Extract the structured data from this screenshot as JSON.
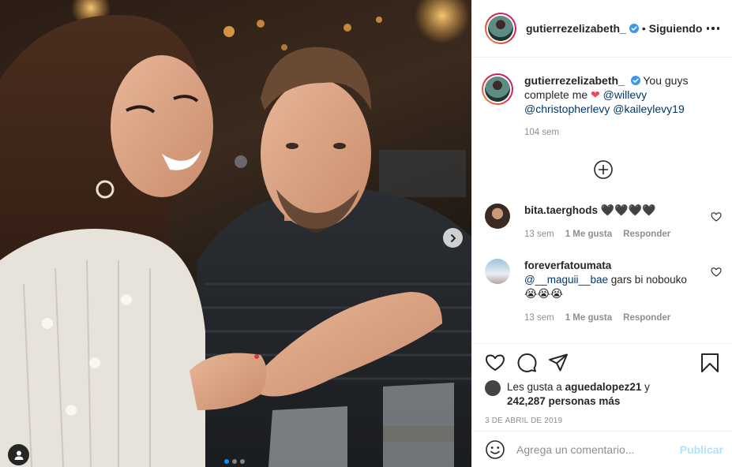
{
  "post": {
    "username": "gutierrezelizabeth_",
    "separator": "•",
    "follow_status": "Siguiendo"
  },
  "caption": {
    "username": "gutierrezelizabeth_",
    "text_1": "You guys complete me",
    "heart": "❤",
    "mention_1": "@willevy",
    "mention_2": "@christopherlevy",
    "mention_3": "@kaileylevy19",
    "time": "104 sem"
  },
  "comments": [
    {
      "username": "bita.taerghods",
      "text": "🖤🖤🖤🖤",
      "time": "13 sem",
      "likes": "1 Me gusta",
      "reply": "Responder"
    },
    {
      "username": "foreverfatoumata",
      "mention": "@__maguii__bae",
      "text": "gars bi nobouko",
      "emojis": "😭😭😭",
      "time": "13 sem",
      "likes": "1 Me gusta",
      "reply": "Responder"
    }
  ],
  "likes": {
    "prefix": "Les gusta a",
    "user": "aguedalopez21",
    "joiner": "y",
    "count": "242,287 personas más"
  },
  "date": "3 DE ABRIL DE 2019",
  "add_comment": {
    "placeholder": "Agrega un comentario...",
    "publish": "Publicar"
  },
  "carousel": {
    "current_index": 1,
    "total": 3
  },
  "colors": {
    "link": "#00376b",
    "verified": "#3897f0",
    "heart": "#ed4956",
    "publish_disabled": "#b2dffc"
  },
  "icons": [
    "verified-icon",
    "more-options-icon",
    "add-circle-icon",
    "heart-outline-icon",
    "comment-icon",
    "share-icon",
    "bookmark-icon",
    "emoji-icon",
    "next-arrow-icon",
    "user-tag-icon"
  ]
}
